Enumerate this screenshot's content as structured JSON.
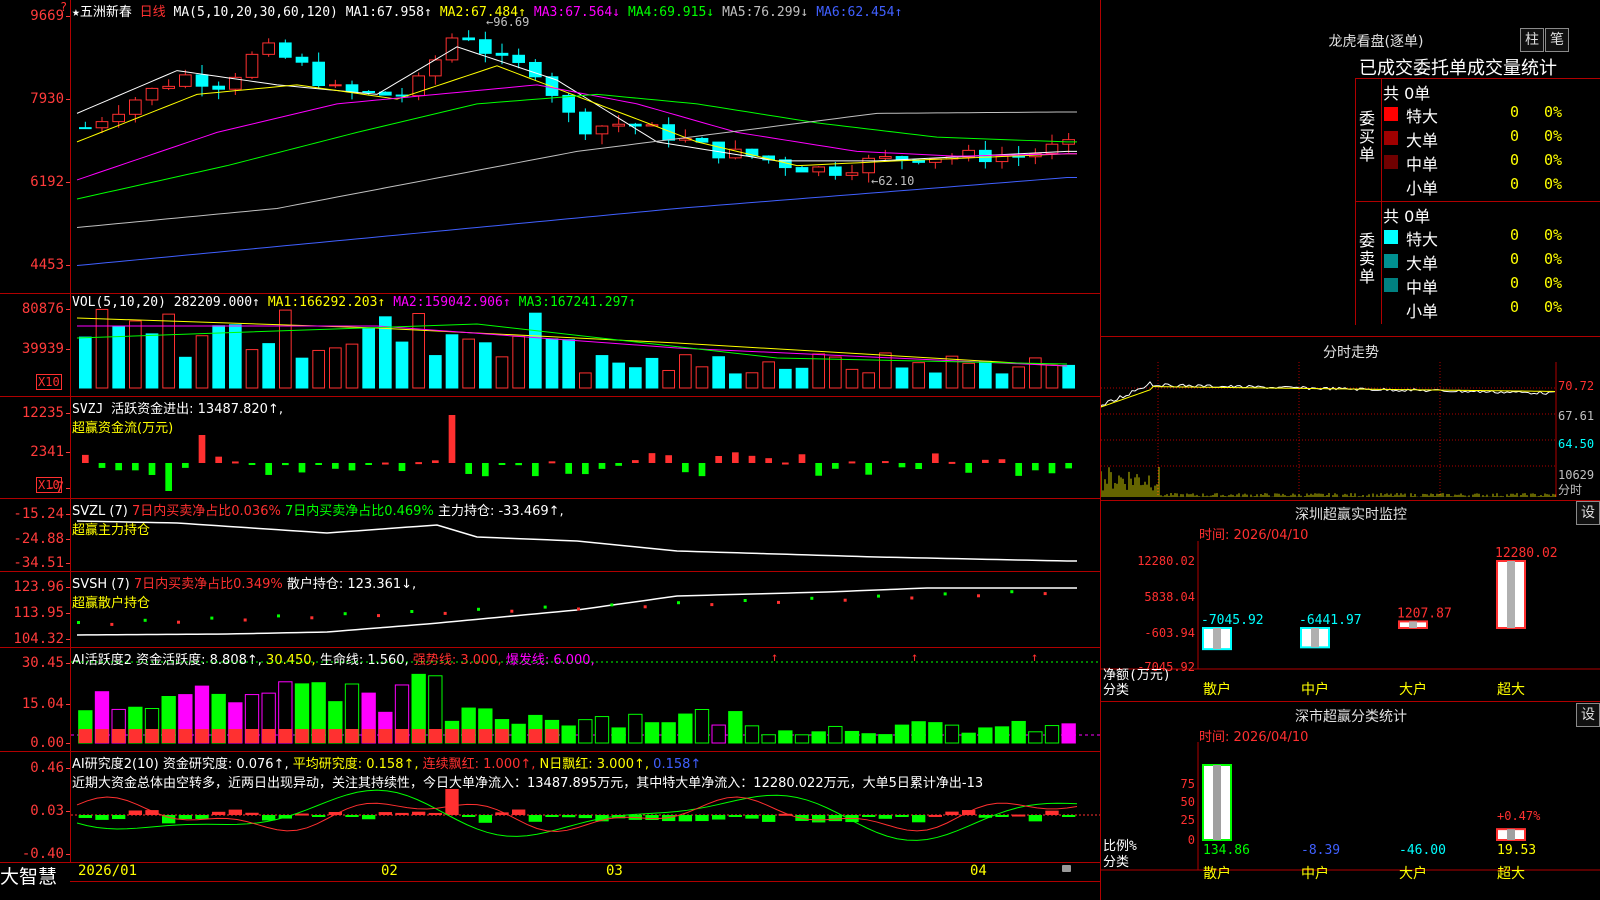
{
  "stock": {
    "name": "五洲新春",
    "period": "日线",
    "star": "★"
  },
  "corner_mark": "?",
  "price_pane": {
    "ma_params": "MA(5,10,20,30,60,120)",
    "ma": [
      {
        "label": "MA1:",
        "value": "67.958",
        "arrow": "↑",
        "color": "#ffffff"
      },
      {
        "label": "MA2:",
        "value": "67.484",
        "arrow": "↑",
        "color": "#ffff00"
      },
      {
        "label": "MA3:",
        "value": "67.564",
        "arrow": "↓",
        "color": "#ff00ff"
      },
      {
        "label": "MA4:",
        "value": "69.915",
        "arrow": "↓",
        "color": "#00ff00"
      },
      {
        "label": "MA5:",
        "value": "76.299",
        "arrow": "↓",
        "color": "#c0c0c0"
      },
      {
        "label": "MA6:",
        "value": "62.454",
        "arrow": "↑",
        "color": "#4060ff"
      }
    ],
    "y_ticks": [
      "9669",
      "7930",
      "6192",
      "4453"
    ],
    "high_annotation": "96.69",
    "low_annotation": "62.10"
  },
  "volume_pane": {
    "params": "VOL(5,10,20)",
    "values": [
      {
        "label": "",
        "value": "282209.000",
        "arrow": "↑",
        "color": "#ffffff"
      },
      {
        "label": "MA1:",
        "value": "166292.203",
        "arrow": "↑",
        "color": "#ffff00"
      },
      {
        "label": "MA2:",
        "value": "159042.906",
        "arrow": "↑",
        "color": "#ff00ff"
      },
      {
        "label": "MA3:",
        "value": "167241.297",
        "arrow": "↑",
        "color": "#00ff00"
      }
    ],
    "y_ticks": [
      "80876",
      "39939"
    ],
    "unit": "X10"
  },
  "svzj_pane": {
    "name": "SVZJ",
    "line1": "活跃资金进出: 13487.820↑,",
    "line2": "超赢资金流(万元)",
    "y_ticks": [
      "12235",
      "2341",
      "-7"
    ],
    "unit": "X10"
  },
  "svzl_pane": {
    "name": "SVZL (7)",
    "seg1": "7日内买卖净占比0.036%",
    "seg2": "7日内买卖净占比0.469%",
    "seg3": "主力持仓: -33.469↑,",
    "line2": "超赢主力持仓",
    "y_ticks": [
      "-15.24",
      "-24.88",
      "-34.51"
    ]
  },
  "svsh_pane": {
    "name": "SVSH (7)",
    "seg1": "7日内买卖净占比0.349%",
    "seg2": "散户持仓: 123.361↓,",
    "line2": "超赢散户持仓",
    "y_ticks": [
      "123.96",
      "113.95",
      "104.32"
    ]
  },
  "ai_active_pane": {
    "name": "AI活跃度2",
    "seg1": "资金活跃度: 8.808↑,",
    "seg2": "30.450,",
    "seg3": "生命线: 1.560,",
    "seg4": "强势线: 3.000,",
    "seg5": "爆发线: 6.000,",
    "y_ticks": [
      "30.45",
      "15.04",
      "0.00"
    ]
  },
  "ai_research_pane": {
    "name": "AI研究度2(10)",
    "seg1": "资金研究度: 0.076↑,",
    "seg2": "平均研究度: 0.158↑,",
    "seg3": "连续飘红: 1.000↑,",
    "seg4": "N日飘红: 3.000↑,",
    "seg5": "0.158↑",
    "comment": "近期大资金总体由空转多，近两日出现异动，关注其持续性，今日大单净流入：13487.895万元，其中特大单净流入：12280.022万元，大单5日累计净出-13",
    "y_ticks": [
      "0.46",
      "0.03",
      "-0.40"
    ]
  },
  "bottom_axis": {
    "brand": "大智慧",
    "dates": [
      "2026/01",
      "02",
      "03",
      "04"
    ]
  },
  "dragon_tiger": {
    "title": "龙虎看盘(逐单)",
    "btn_bar": "柱",
    "btn_pen": "笔",
    "subtitle": "已成交委托单成交量统计",
    "buy_label": "委买单",
    "sell_label": "委卖单",
    "buy_total": "共 0单",
    "sell_total": "共 0单",
    "buy_rows": [
      {
        "name": "特大",
        "count": "0",
        "pct": "0%",
        "color": "#ff0000"
      },
      {
        "name": "大单",
        "count": "0",
        "pct": "0%",
        "color": "#a00000"
      },
      {
        "name": "中单",
        "count": "0",
        "pct": "0%",
        "color": "#700000"
      },
      {
        "name": "小单",
        "count": "0",
        "pct": "0%",
        "color": "#000000"
      }
    ],
    "sell_rows": [
      {
        "name": "特大",
        "count": "0",
        "pct": "0%",
        "color": "#00ffff"
      },
      {
        "name": "大单",
        "count": "0",
        "pct": "0%",
        "color": "#009090"
      },
      {
        "name": "中单",
        "count": "0",
        "pct": "0%",
        "color": "#008080"
      },
      {
        "name": "小单",
        "count": "0",
        "pct": "0%",
        "color": "#000000"
      }
    ]
  },
  "intraday": {
    "title": "分时走势",
    "prices": [
      "70.72",
      "67.61",
      "64.50"
    ],
    "volume_label": "10629",
    "volume_unit": "分时"
  },
  "sz_monitor": {
    "title": "深圳超赢实时监控",
    "btn": "设",
    "time": "时间: 2026/04/10",
    "y_ticks": [
      "12280.02",
      "5838.04",
      "-603.94",
      "-7045.92"
    ],
    "ylabel": "净额(万元)",
    "xlabel": "分类",
    "categories": [
      "散户",
      "中户",
      "大户",
      "超大"
    ],
    "values": [
      -7045.92,
      -6441.97,
      1207.87,
      12280.02
    ],
    "value_labels": [
      "-7045.92",
      "-6441.97",
      "1207.87",
      "12280.02"
    ]
  },
  "sz_class": {
    "title": "深市超赢分类统计",
    "btn": "设",
    "time": "时间: 2026/04/10",
    "y_ticks": [
      "75",
      "50",
      "25",
      "0"
    ],
    "ylabel": "比例%",
    "xlabel": "分类",
    "categories": [
      "散户",
      "中户",
      "大户",
      "超大"
    ],
    "values": [
      134.86,
      -8.39,
      -46.0,
      19.53
    ],
    "value_labels": [
      "134.86",
      "-8.39",
      "-46.00",
      "19.53"
    ],
    "extra_label": "+0.47%"
  },
  "colors": {
    "up": "#ff3030",
    "down": "#00ffff",
    "grid": "#b00000",
    "bg": "#000000"
  }
}
